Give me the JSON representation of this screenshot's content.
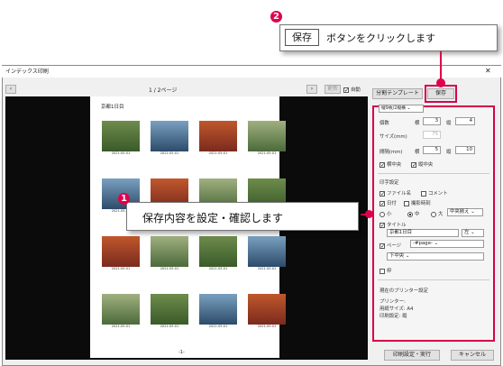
{
  "window": {
    "title": "インデックス印刷"
  },
  "nav": {
    "page_indicator": "1 / 2ページ",
    "update_label": "更新",
    "auto_label": "自動"
  },
  "tabs": {
    "split_template": "分割テンプレート",
    "save": "保存"
  },
  "preview": {
    "page_title": "京都1日目",
    "page_number": "-1-",
    "captions": [
      [
        "2021.05.01",
        "2021.05.01",
        "2021.05.01",
        "2021.05.01"
      ],
      [
        "2021.05.01",
        "2021.05.01",
        "2021.05.01",
        "2021.05.01"
      ],
      [
        "2021.05.01",
        "2021.05.01",
        "2021.05.01",
        "2021.05.01"
      ],
      [
        "2021.05.01",
        "2021.05.01",
        "2021.05.01",
        "2021.05.01"
      ]
    ]
  },
  "settings": {
    "layout_select": "縦9枚/2縦横",
    "count_label": "個数",
    "cols_label": "横",
    "cols_value": "3",
    "rows_label": "縦",
    "rows_value": "4",
    "size_label": "サイズ(mm)",
    "size_value": "75",
    "gap_label": "間隔(mm)",
    "gap_h_label": "横",
    "gap_h_value": "5",
    "gap_v_label": "縦",
    "gap_v_value": "10",
    "center_h_label": "横中央",
    "center_v_label": "縦中央",
    "print_section": "印字設定",
    "filename_label": "ファイル名",
    "comment_label": "コメント",
    "date_label": "日付",
    "shot_time_label": "撮影時刻",
    "size_small": "小",
    "size_medium": "中",
    "size_large": "大",
    "align_select": "中央揃え",
    "title_label": "タイトル",
    "title_value": "京都1日目",
    "title_align": "左",
    "page_label": "ページ",
    "page_format": "-#page-",
    "page_position": "下中央",
    "frame_label": "枠",
    "printer_section": "現在のプリンター設定",
    "printer_label": "プリンター:",
    "paper_label": "用紙サイズ: A4",
    "orientation_label": "印刷設定: 縦"
  },
  "footer": {
    "print_button": "印刷設定・実行",
    "cancel_button": "キャンセル"
  },
  "callouts": {
    "step1_number": "1",
    "step1_text": "保存内容を設定・確認します",
    "step2_number": "2",
    "step2_button": "保存",
    "step2_text": "ボタンをクリックします"
  },
  "colors": {
    "accent": "#e0004d"
  }
}
